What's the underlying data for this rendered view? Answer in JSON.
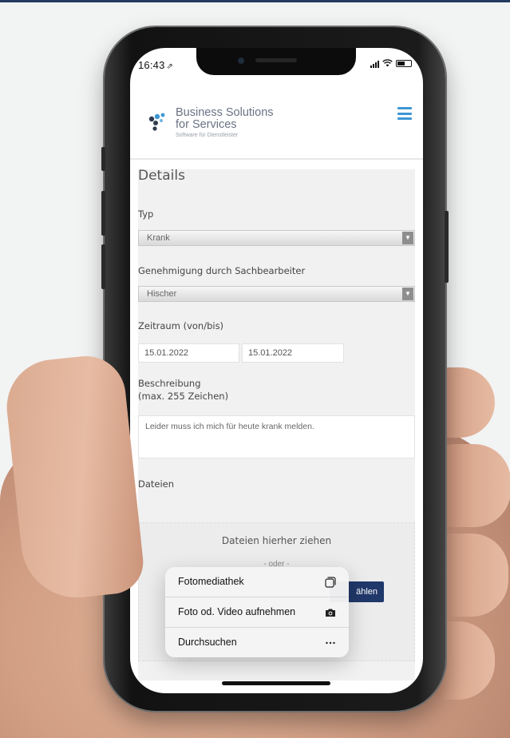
{
  "status_bar": {
    "time": "16:43",
    "location_glyph": "⇗"
  },
  "brand": {
    "title_line1": "Business Solutions",
    "title_line2": "for Services",
    "subtitle": "Software für Dienstleister",
    "accent_color": "#3e96d5"
  },
  "form": {
    "section_title": "Details",
    "type": {
      "label": "Typ",
      "value": "Krank"
    },
    "approval": {
      "label": "Genehmigung durch Sachbearbeiter",
      "value": "Hischer"
    },
    "period": {
      "label": "Zeitraum (von/bis)",
      "from": "15.01.2022",
      "to": "15.01.2022"
    },
    "description": {
      "label_line1": "Beschreibung",
      "label_line2": "(max. 255 Zeichen)",
      "value": "Leider muss ich mich für heute krank melden."
    },
    "files": {
      "label": "Dateien",
      "drop_text": "Dateien hierher ziehen",
      "or_text": "- oder -",
      "button_label_visible": "ählen",
      "button_color": "#20386a"
    }
  },
  "popup_menu": {
    "items": [
      {
        "label": "Fotomediathek",
        "icon": "photo-library-icon"
      },
      {
        "label": "Foto od. Video aufnehmen",
        "icon": "camera-icon"
      },
      {
        "label": "Durchsuchen",
        "icon": "more-icon"
      }
    ]
  }
}
